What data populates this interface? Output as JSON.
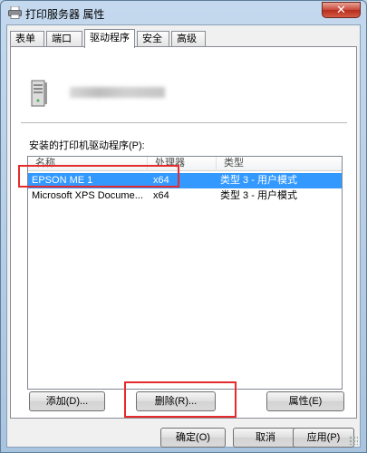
{
  "window": {
    "title": "打印服务器 属性",
    "close_label": "✕"
  },
  "tabs": [
    "表单",
    "端口",
    "驱动程序",
    "安全",
    "高级"
  ],
  "active_tab": "驱动程序",
  "panel": {
    "drivers_label": "安装的打印机驱动程序(P):",
    "columns": [
      "名称",
      "处理器",
      "类型"
    ],
    "rows": [
      {
        "name": "EPSON ME 1",
        "processor": "x64",
        "type": "类型 3 - 用户模式",
        "selected": true
      },
      {
        "name": "Microsoft XPS Docume...",
        "processor": "x64",
        "type": "类型 3 - 用户模式",
        "selected": false
      }
    ],
    "buttons": {
      "add": "添加(D)...",
      "remove": "删除(R)...",
      "properties": "属性(E)"
    }
  },
  "footer": {
    "ok": "确定(O)",
    "cancel": "取消",
    "apply": "应用(P)"
  },
  "colors": {
    "selection": "#3399ff",
    "highlight_box": "#e52b2b"
  }
}
